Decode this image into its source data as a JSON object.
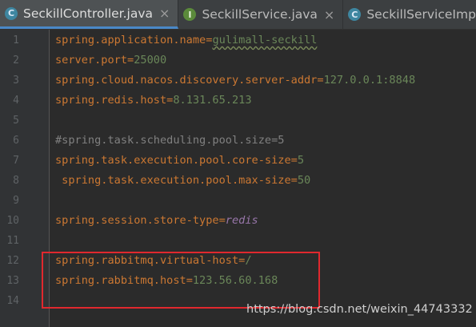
{
  "tabs": [
    {
      "label": "SeckillController.java",
      "icon": "class-icon",
      "close": "×"
    },
    {
      "label": "SeckillService.java",
      "icon": "interface-icon",
      "close": "×"
    },
    {
      "label": "SeckillServiceImpl.java",
      "icon": "class-icon",
      "close": ""
    }
  ],
  "tab_icon_letters": {
    "class": "C",
    "interface": "I"
  },
  "lines": [
    {
      "n": "1",
      "key": "spring.application.name",
      "eq": "=",
      "val": "gulimall-seckill"
    },
    {
      "n": "2",
      "key": "server.port",
      "eq": "=",
      "val": "25000"
    },
    {
      "n": "3",
      "key": "spring.cloud.nacos.discovery.server-addr",
      "eq": "=",
      "val": "127.0.0.1:8848"
    },
    {
      "n": "4",
      "key": "spring.redis.host",
      "eq": "=",
      "val": "8.131.65.213"
    },
    {
      "n": "5"
    },
    {
      "n": "6",
      "comment": "#spring.task.scheduling.pool.size=5"
    },
    {
      "n": "7",
      "key": "spring.task.execution.pool.core-size",
      "eq": "=",
      "val": "5"
    },
    {
      "n": "8",
      "key": " spring.task.execution.pool.max-size",
      "eq": "=",
      "val": "50"
    },
    {
      "n": "9"
    },
    {
      "n": "10",
      "key": "spring.session.store-type",
      "eq": "=",
      "val": "redis"
    },
    {
      "n": "11"
    },
    {
      "n": "12",
      "key": "spring.rabbitmq.virtual-host",
      "eq": "=",
      "val": "/"
    },
    {
      "n": "13",
      "key": "spring.rabbitmq.host",
      "eq": "=",
      "val": "123.56.60.168"
    },
    {
      "n": "14"
    }
  ],
  "watermark": "https://blog.csdn.net/weixin_44743332",
  "colors": {
    "background": "#2b2b2b",
    "key": "#cc7832",
    "value": "#6a8759",
    "comment": "#808080",
    "italic_value": "#9876aa",
    "highlight_box": "#e0282e"
  }
}
